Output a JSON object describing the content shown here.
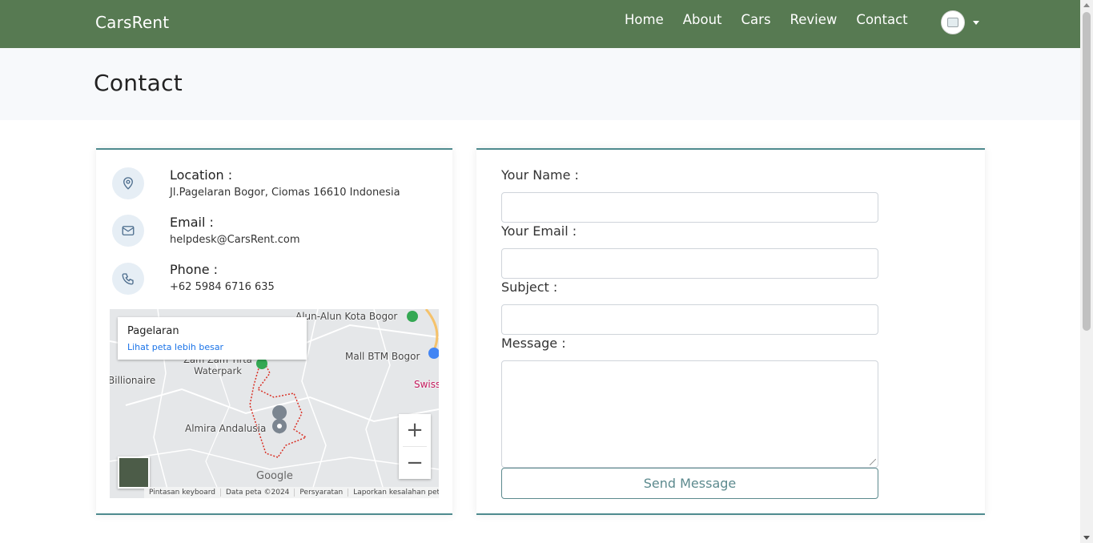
{
  "navbar": {
    "brand": "CarsRent",
    "links": [
      "Home",
      "About",
      "Cars",
      "Review",
      "Contact"
    ],
    "bg_color": "#577a52"
  },
  "page": {
    "title": "Contact"
  },
  "contact_info": {
    "location": {
      "label": "Location :",
      "value": "Jl.Pagelaran Bogor, Ciomas 16610 Indonesia",
      "icon": "map-pin-icon"
    },
    "email": {
      "label": "Email :",
      "value": "helpdesk@CarsRent.com",
      "icon": "mail-icon"
    },
    "phone": {
      "label": "Phone :",
      "value": "+62 5984 6716 635",
      "icon": "phone-icon"
    }
  },
  "map": {
    "popup_title": "Pagelaran",
    "popup_link": "Lihat peta lebih besar",
    "labels": [
      "Alun-Alun Kota Bogor",
      "Mall BTM Bogor",
      "Zam Zam Tirta Waterpark",
      "Billionaire",
      "Swiss",
      "Almira Andalusia"
    ],
    "logo": "Google",
    "footer": [
      "Pintasan keyboard",
      "Data peta ©2024",
      "Persyaratan",
      "Laporkan kesalahan peta"
    ],
    "zoom_in": "+",
    "zoom_out": "−"
  },
  "form": {
    "name_label": "Your Name :",
    "email_label": "Your Email :",
    "subject_label": "Subject :",
    "message_label": "Message :",
    "submit_label": "Send Message",
    "accent_color": "#5c8a8e"
  }
}
